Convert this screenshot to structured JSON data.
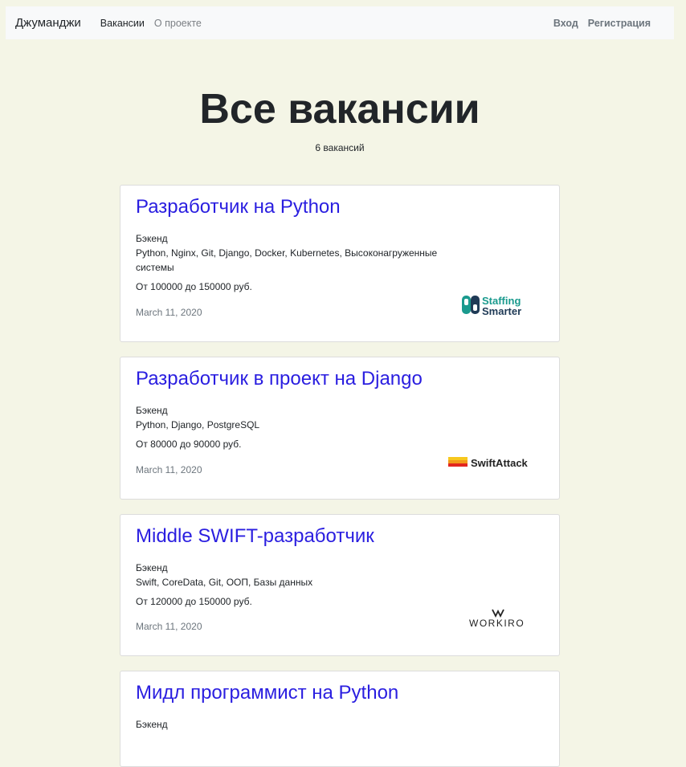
{
  "nav": {
    "brand": "Джуманджи",
    "links": [
      "Вакансии",
      "О проекте"
    ],
    "auth": [
      "Вход",
      "Регистрация"
    ]
  },
  "header": {
    "title": "Все вакансии",
    "count": "6 вакансий"
  },
  "vacancies": [
    {
      "title": "Разработчик на Python",
      "specialty": "Бэкенд",
      "skills": "Python, Nginx, Git, Django, Docker, Kubernetes, Высоконагруженные системы",
      "salary": "От 100000 до 150000 руб.",
      "date": "March 11, 2020",
      "logo": {
        "line1": "Staffing",
        "line2": "Smarter"
      }
    },
    {
      "title": "Разработчик в проект на Django",
      "specialty": "Бэкенд",
      "skills": "Python, Django, PostgreSQL",
      "salary": "От 80000 до 90000 руб.",
      "date": "March 11, 2020",
      "logo": {
        "text": "SwiftAttack"
      }
    },
    {
      "title": "Middle SWIFT-разработчик",
      "specialty": "Бэкенд",
      "skills": "Swift, CoreData, Git, ООП, Базы данных",
      "salary": "От 120000 до 150000 руб.",
      "date": "March 11, 2020",
      "logo": {
        "text": "WORKIRO"
      }
    },
    {
      "title": "Мидл программист на Python",
      "specialty": "Бэкенд"
    }
  ],
  "colors": {
    "background": "#f4f5e6",
    "link": "#2a1ee0",
    "muted": "#6c757d"
  }
}
